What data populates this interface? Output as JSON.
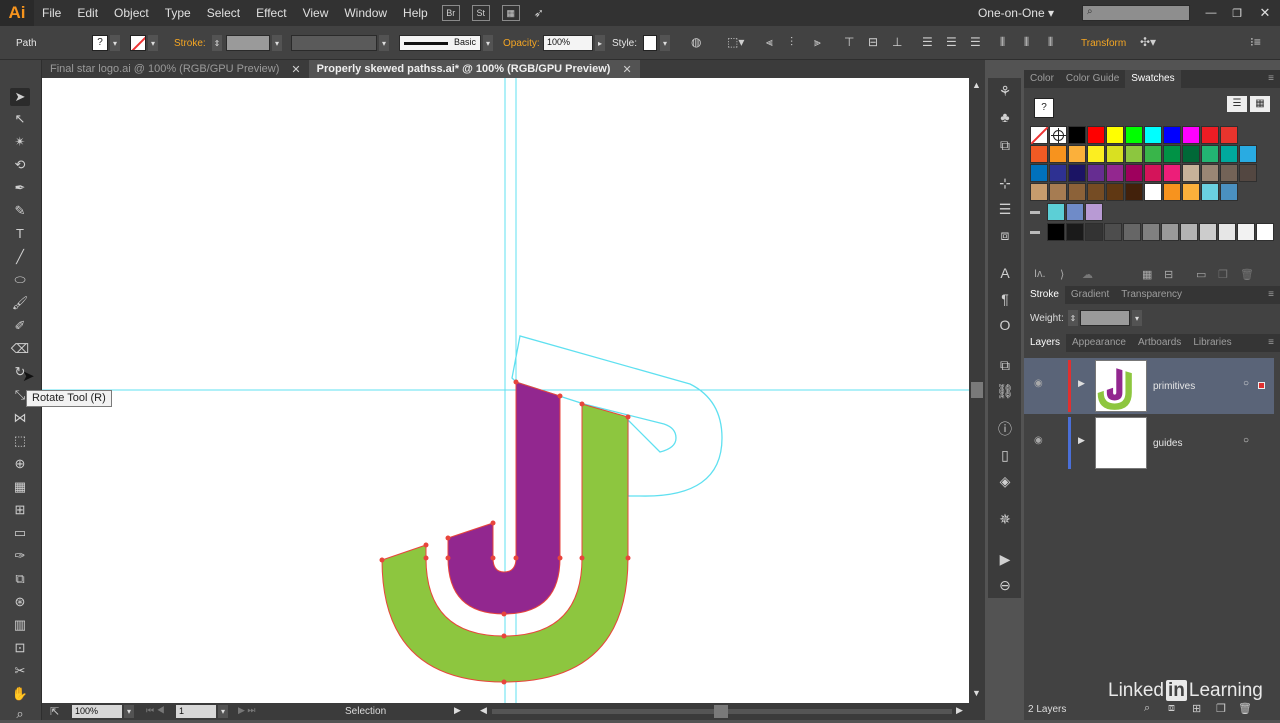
{
  "app": {
    "logo": "Ai",
    "workspace": "One-on-One",
    "br": "Br",
    "st": "St"
  },
  "menu": [
    "File",
    "Edit",
    "Object",
    "Type",
    "Select",
    "Effect",
    "View",
    "Window",
    "Help"
  ],
  "control": {
    "selection_label": "Path",
    "stroke_label": "Stroke:",
    "brush_label": "Basic",
    "opacity_label": "Opacity:",
    "opacity_value": "100%",
    "style_label": "Style:",
    "transform_label": "Transform"
  },
  "tabs": [
    {
      "label": "Final star logo.ai @ 100% (RGB/GPU Preview)",
      "active": false
    },
    {
      "label": "Properly skewed pathss.ai* @ 100% (RGB/GPU Preview)",
      "active": true
    }
  ],
  "tooltip": "Rotate Tool (R)",
  "status": {
    "zoom": "100%",
    "artboard": "1",
    "mode": "Selection"
  },
  "panel_swatches": {
    "tabs": [
      "Color",
      "Color Guide",
      "Swatches"
    ],
    "active": "Swatches"
  },
  "panel_stroke": {
    "tabs": [
      "Stroke",
      "Gradient",
      "Transparency"
    ],
    "active": "Stroke",
    "weight_label": "Weight:"
  },
  "panel_layers": {
    "tabs": [
      "Layers",
      "Appearance",
      "Artboards",
      "Libraries"
    ],
    "active": "Layers",
    "layers": [
      {
        "name": "primitives",
        "color": "#e03030"
      },
      {
        "name": "guides",
        "color": "#4a6fd8"
      }
    ],
    "footer": "2 Layers"
  },
  "watermark": {
    "left": "Linked",
    "in": "in",
    "right": "Learning"
  },
  "colors": {
    "green": "#8dc63f",
    "purple": "#92278f",
    "guide": "#5fe0f0",
    "anchor": "#e8453c"
  },
  "swatch_rows": [
    [
      "#ffffff",
      "#ffffff",
      "#000000",
      "#ff0000",
      "#ffff00",
      "#00ff00",
      "#00ffff",
      "#0000ff",
      "#ff00ff",
      "#ed1c24",
      "#e8342d"
    ],
    [
      "#f15a24",
      "#f7931e",
      "#fbb03b",
      "#fcee21",
      "#d9e021",
      "#8cc63f",
      "#39b54a",
      "#009245",
      "#006837",
      "#22b573",
      "#00a99d",
      "#29abe2"
    ],
    [
      "#0071bc",
      "#2e3192",
      "#1b1464",
      "#662d91",
      "#93278f",
      "#9e005d",
      "#d4145a",
      "#ed1e79",
      "#c7b299",
      "#998675",
      "#736357",
      "#534741"
    ],
    [
      "#c69c6d",
      "#a67c52",
      "#8c6239",
      "#754c24",
      "#603813",
      "#42210b",
      "#ffffff",
      "#f7931e",
      "#fbb03b",
      "#6ad0e0",
      "#4a90c0"
    ],
    [
      "#5ccfd6",
      "#6f8bc8",
      "#b89ad4"
    ],
    [
      "#000000",
      "#1a1a1a",
      "#333333",
      "#4d4d4d",
      "#666666",
      "#808080",
      "#999999",
      "#b3b3b3",
      "#cccccc",
      "#e6e6e6",
      "#f2f2f2",
      "#ffffff"
    ]
  ]
}
